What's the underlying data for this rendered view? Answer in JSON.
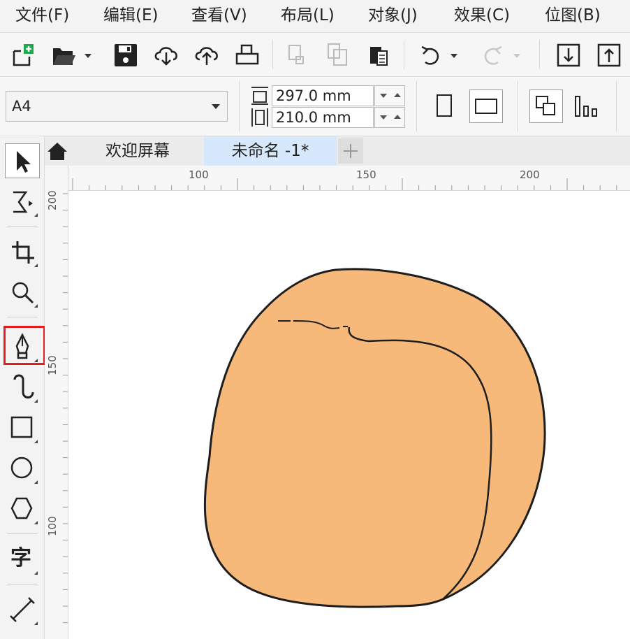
{
  "menu": {
    "items": [
      {
        "label": "文件(F)"
      },
      {
        "label": "编辑(E)"
      },
      {
        "label": "查看(V)"
      },
      {
        "label": "布局(L)"
      },
      {
        "label": "对象(J)"
      },
      {
        "label": "效果(C)"
      },
      {
        "label": "位图(B)"
      }
    ]
  },
  "toolbar": {
    "icons": [
      "new-document-icon",
      "open-folder-icon",
      "save-icon",
      "import-cloud-icon",
      "export-cloud-icon",
      "print-icon",
      "cut-icon",
      "copy-icon",
      "paste-icon",
      "undo-icon",
      "redo-icon",
      "import-icon",
      "export-icon"
    ]
  },
  "property_bar": {
    "page_size": "A4",
    "height_value": "297.0 mm",
    "width_value": "210.0 mm"
  },
  "tabs": {
    "welcome": "欢迎屏幕",
    "document": "未命名 -1*"
  },
  "ruler": {
    "h_labels": [
      "100",
      "150",
      "200"
    ],
    "v_labels": [
      "200",
      "150",
      "100"
    ]
  },
  "tools": {
    "text_tool_glyph": "字",
    "highlighted_tool": "pen-tool"
  },
  "colors": {
    "peach_fill": "#f7b97a",
    "outline": "#1e1e1e",
    "highlight": "#e02020",
    "active_tab": "#d6e8fb"
  }
}
